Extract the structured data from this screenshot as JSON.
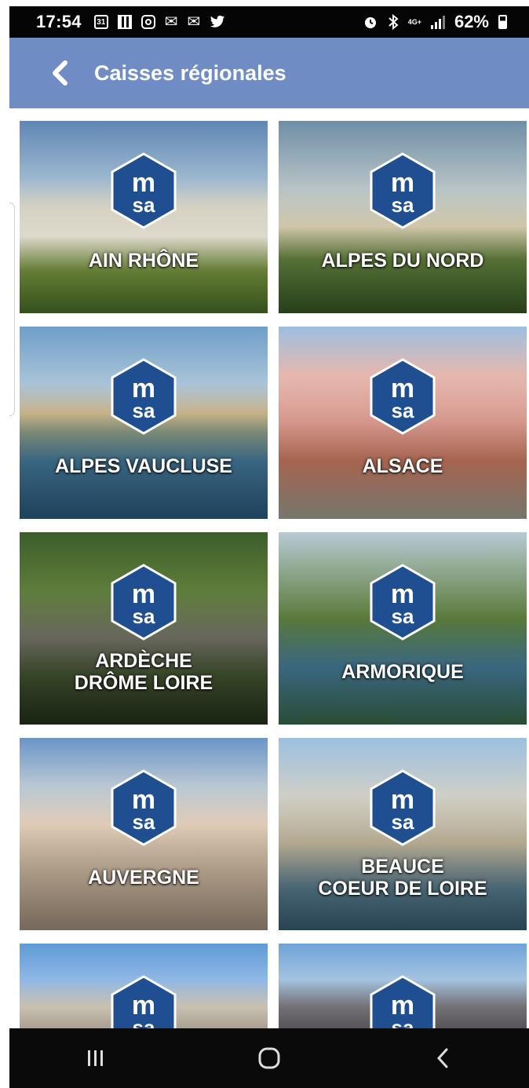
{
  "status_bar": {
    "time": "17:54",
    "calendar_day": "31",
    "network": "4G+",
    "battery": "62%"
  },
  "app_bar": {
    "title": "Caisses régionales"
  },
  "colors": {
    "app_bar": "#6f8dc4",
    "logo_blue": "#1f4e91"
  },
  "logo": {
    "top": "m",
    "bottom": "sa"
  },
  "regions": [
    {
      "label": "AIN RHÔNE",
      "scene": "church"
    },
    {
      "label": "ALPES DU NORD",
      "scene": "spire"
    },
    {
      "label": "ALPES VAUCLUSE",
      "scene": "bridge"
    },
    {
      "label": "ALSACE",
      "scene": "townhall"
    },
    {
      "label": "ARDÈCHE\nDRÔME LOIRE",
      "scene": "train"
    },
    {
      "label": "ARMORIQUE",
      "scene": "harbor"
    },
    {
      "label": "AUVERGNE",
      "scene": "square"
    },
    {
      "label": "BEAUCE\nCOEUR DE LOIRE",
      "scene": "river"
    },
    {
      "label": "",
      "scene": "tower"
    },
    {
      "label": "",
      "scene": "cathedral"
    }
  ]
}
